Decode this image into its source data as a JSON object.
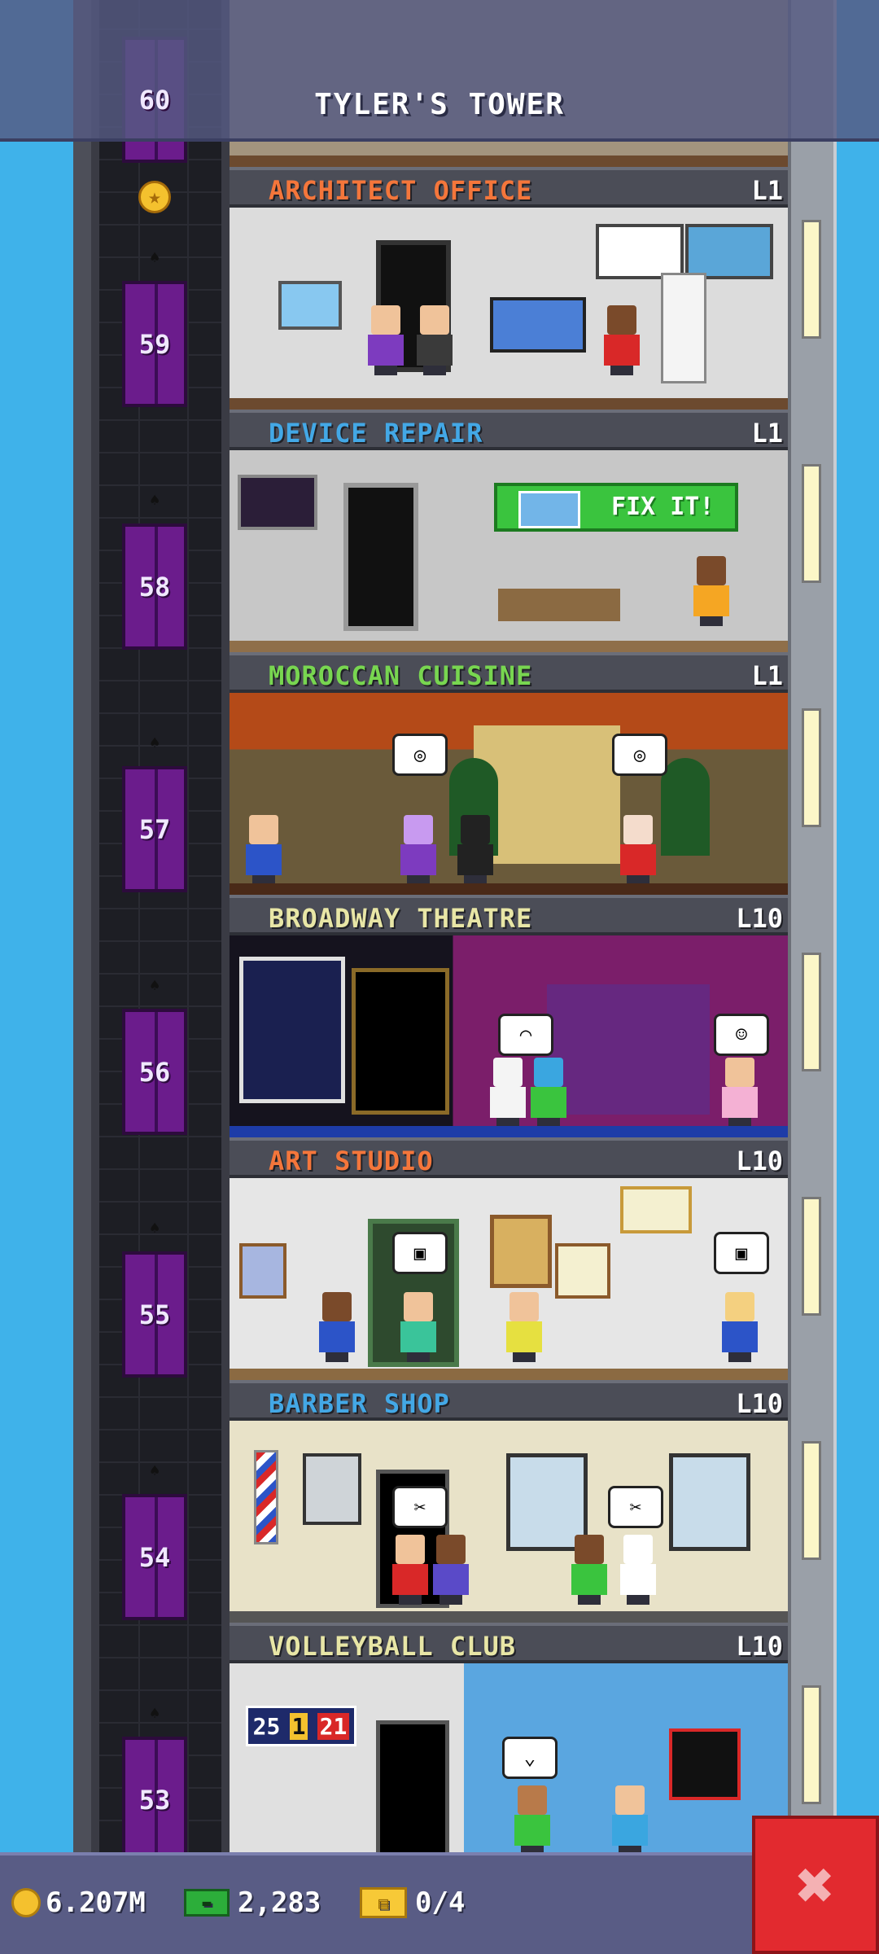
{
  "tower": {
    "title": "TYLER'S TOWER"
  },
  "elevator_labels": [
    "60",
    "59",
    "58",
    "57",
    "56",
    "55",
    "54",
    "53"
  ],
  "floors": [
    {
      "name": "ARCHITECT OFFICE",
      "level": "L1",
      "color": "#f4763b"
    },
    {
      "name": "DEVICE REPAIR",
      "level": "L1",
      "color": "#43a8e6"
    },
    {
      "name": "MOROCCAN CUISINE",
      "level": "L1",
      "color": "#78d650"
    },
    {
      "name": "BROADWAY THEATRE",
      "level": "L10",
      "color": "#e8e6a6"
    },
    {
      "name": "ART STUDIO",
      "level": "L10",
      "color": "#f4763b"
    },
    {
      "name": "BARBER SHOP",
      "level": "L10",
      "color": "#43a8e6"
    },
    {
      "name": "VOLLEYBALL CLUB",
      "level": "L10",
      "color": "#e8e6a6"
    }
  ],
  "device_repair": {
    "fix_label": "FIX IT!"
  },
  "volleyball": {
    "score_left": "25",
    "score_mid": "1",
    "score_right": "21"
  },
  "bottom_bar": {
    "coins": "6.207M",
    "bux": "2,283",
    "tickets": "0/4"
  },
  "colors": {
    "sky": "#3fb2ea",
    "close": "#e22a2f"
  }
}
